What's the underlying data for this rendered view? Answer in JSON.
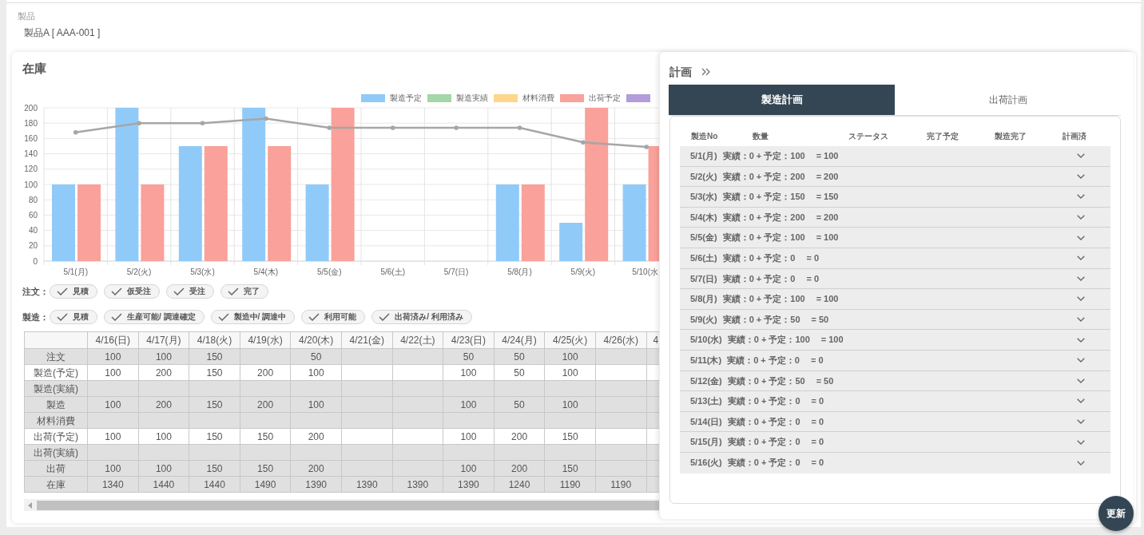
{
  "product": {
    "label": "製品",
    "value": "製品A [ AAA-001 ]"
  },
  "stock": {
    "title": "在庫",
    "chart_data": {
      "type": "bar",
      "grid": true,
      "categories": [
        "5/1(月)",
        "5/2(火)",
        "5/3(水)",
        "5/4(木)",
        "5/5(金)",
        "5/6(土)",
        "5/7(日)",
        "5/8(月)",
        "5/9(火)",
        "5/10(水"
      ],
      "ylim": [
        0,
        200
      ],
      "yticks": [
        0,
        20,
        40,
        60,
        80,
        100,
        120,
        140,
        160,
        180,
        200
      ],
      "series": [
        {
          "name": "製造予定",
          "color": "#90caf9",
          "values": [
            100,
            200,
            150,
            200,
            100,
            0,
            0,
            100,
            50,
            100
          ]
        },
        {
          "name": "製造実績",
          "color": "#a5d6a7",
          "values": [
            null,
            null,
            null,
            null,
            null,
            null,
            null,
            null,
            null,
            null
          ]
        },
        {
          "name": "材料消費",
          "color": "#ffd68a",
          "values": [
            null,
            null,
            null,
            null,
            null,
            null,
            null,
            null,
            null,
            null
          ]
        },
        {
          "name": "出荷予定",
          "color": "#f9a19a",
          "values": [
            100,
            100,
            150,
            150,
            200,
            0,
            0,
            100,
            200,
            150
          ]
        },
        {
          "color": "#b39ddb",
          "values": [
            null,
            null,
            null,
            null,
            null,
            null,
            null,
            null,
            null,
            null
          ]
        },
        {
          "type": "line",
          "color": "#a6a6a6",
          "values": [
            168,
            180,
            180,
            186,
            174,
            174,
            174,
            174,
            155,
            149
          ]
        }
      ]
    },
    "filters": [
      {
        "label": "注文：",
        "chips": [
          {
            "label": "見積",
            "checked": true
          },
          {
            "label": "仮受注",
            "checked": true
          },
          {
            "label": "受注",
            "checked": true
          },
          {
            "label": "完了",
            "checked": true
          }
        ]
      },
      {
        "label": "製造：",
        "chips": [
          {
            "label": "見積",
            "checked": true
          },
          {
            "label": "生産可能/ 調達確定",
            "checked": true
          },
          {
            "label": "製造中/ 調達中",
            "checked": true
          },
          {
            "label": "利用可能",
            "checked": true
          },
          {
            "label": "出荷済み/ 利用済み",
            "checked": true
          }
        ]
      }
    ],
    "table": {
      "columns": [
        "4/16(日)",
        "4/17(月)",
        "4/18(火)",
        "4/19(水)",
        "4/20(木)",
        "4/21(金)",
        "4/22(土)",
        "4/23(日)",
        "4/24(月)",
        "4/25(火)",
        "4/26(水)",
        "4"
      ],
      "rows": [
        {
          "label": "注文",
          "editable": false,
          "cells": [
            "100",
            "100",
            "150",
            null,
            "50",
            null,
            null,
            "50",
            "50",
            "100",
            null
          ]
        },
        {
          "label": "製造(予定)",
          "editable": true,
          "cells": [
            "100",
            "200",
            "150",
            "200",
            "100",
            null,
            null,
            "100",
            "50",
            "100",
            null
          ]
        },
        {
          "label": "製造(実績)",
          "editable": false,
          "cells": [
            null,
            null,
            null,
            null,
            null,
            null,
            null,
            null,
            null,
            null,
            null
          ]
        },
        {
          "label": "製造",
          "editable": false,
          "cells": [
            "100",
            "200",
            "150",
            "200",
            "100",
            null,
            null,
            "100",
            "50",
            "100",
            null
          ]
        },
        {
          "label": "材料消費",
          "editable": false,
          "cells": [
            null,
            null,
            null,
            null,
            null,
            null,
            null,
            null,
            null,
            null,
            null
          ]
        },
        {
          "label": "出荷(予定)",
          "editable": true,
          "cells": [
            "100",
            "100",
            "150",
            "150",
            "200",
            null,
            null,
            "100",
            "200",
            "150",
            null
          ]
        },
        {
          "label": "出荷(実績)",
          "editable": false,
          "cells": [
            null,
            null,
            null,
            null,
            null,
            null,
            null,
            null,
            null,
            null,
            null
          ]
        },
        {
          "label": "出荷",
          "editable": false,
          "cells": [
            "100",
            "100",
            "150",
            "150",
            "200",
            null,
            null,
            "100",
            "200",
            "150",
            null
          ]
        },
        {
          "label": "在庫",
          "editable": false,
          "cells": [
            "1340",
            "1440",
            "1440",
            "1490",
            "1390",
            "1390",
            "1390",
            "1390",
            "1240",
            "1190",
            "1190"
          ]
        }
      ]
    }
  },
  "plan": {
    "title": "計画",
    "tabs": [
      {
        "label": "製造計画",
        "selected": true
      },
      {
        "label": "出荷計画",
        "selected": false
      }
    ],
    "columns": [
      "製造No",
      "数量",
      "ステータス",
      "完了予定",
      "製造完了",
      "計画済"
    ],
    "rows": [
      {
        "date": "5/1(月)",
        "summary": "実績：0 + 予定：100",
        "total": "= 100",
        "expanded": false
      },
      {
        "date": "5/2(火)",
        "summary": "実績：0 + 予定：200",
        "total": "= 200",
        "expanded": false
      },
      {
        "date": "5/3(水)",
        "summary": "実績：0 + 予定：150",
        "total": "= 150",
        "expanded": false
      },
      {
        "date": "5/4(木)",
        "summary": "実績：0 + 予定：200",
        "total": "= 200",
        "expanded": false
      },
      {
        "date": "5/5(金)",
        "summary": "実績：0 + 予定：100",
        "total": "= 100",
        "expanded": false
      },
      {
        "date": "5/6(土)",
        "summary": "実績：0 + 予定：0",
        "total": "= 0",
        "expanded": false
      },
      {
        "date": "5/7(日)",
        "summary": "実績：0 + 予定：0",
        "total": "= 0",
        "expanded": false
      },
      {
        "date": "5/8(月)",
        "summary": "実績：0 + 予定：100",
        "total": "= 100",
        "expanded": false
      },
      {
        "date": "5/9(火)",
        "summary": "実績：0 + 予定：50",
        "total": "= 50",
        "expanded": false
      },
      {
        "date": "5/10(水)",
        "summary": "実績：0 + 予定：100",
        "total": "= 100",
        "expanded": false
      },
      {
        "date": "5/11(木)",
        "summary": "実績：0 + 予定：0",
        "total": "= 0",
        "expanded": false
      },
      {
        "date": "5/12(金)",
        "summary": "実績：0 + 予定：50",
        "total": "= 50",
        "expanded": false
      },
      {
        "date": "5/13(土)",
        "summary": "実績：0 + 予定：0",
        "total": "= 0",
        "expanded": false
      },
      {
        "date": "5/14(日)",
        "summary": "実績：0 + 予定：0",
        "total": "= 0",
        "expanded": false
      },
      {
        "date": "5/15(月)",
        "summary": "実績：0 + 予定：0",
        "total": "= 0",
        "expanded": false
      },
      {
        "date": "5/16(火)",
        "summary": "実績：0 + 予定：0",
        "total": "= 0",
        "expanded": false
      }
    ]
  },
  "refresh_button": {
    "label": "更新"
  }
}
